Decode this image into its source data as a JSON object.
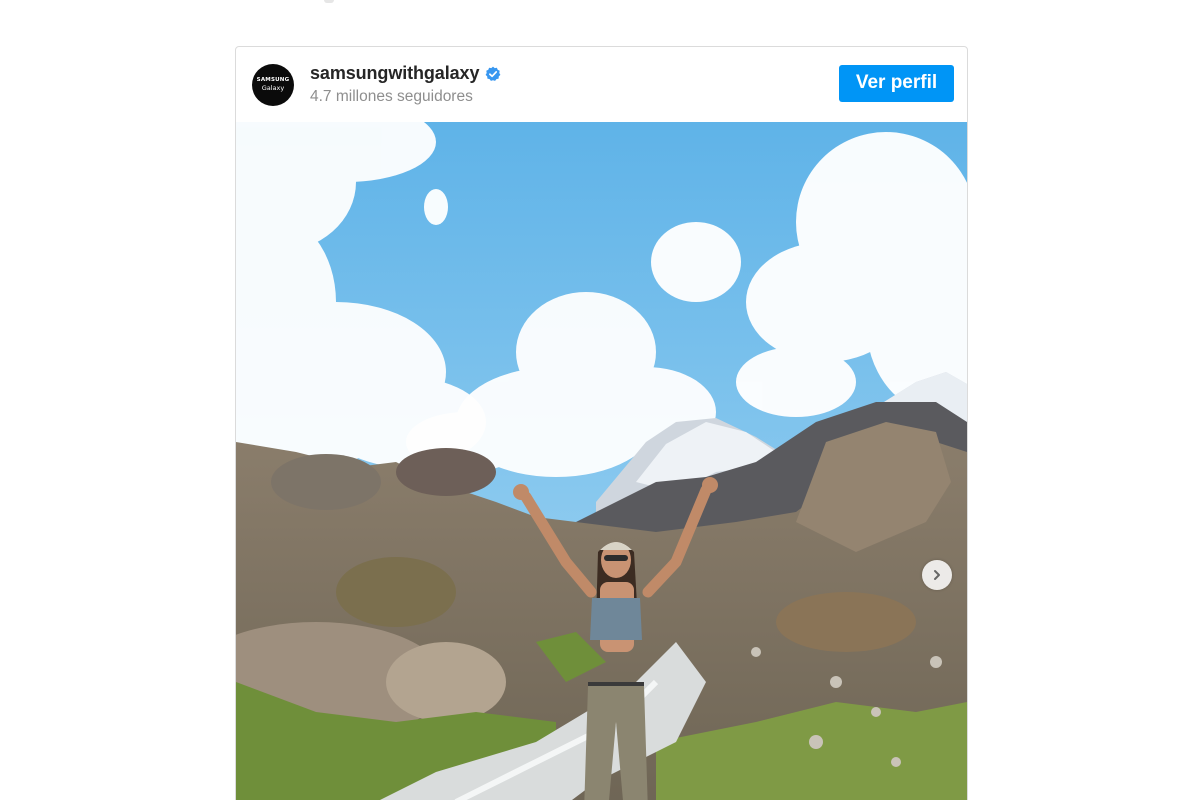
{
  "account": {
    "username": "samsungwithgalaxy",
    "followers": "4.7 millones seguidores",
    "avatar_text_line1": "SAMSUNG",
    "avatar_text_line2": "Galaxy",
    "verified": true
  },
  "actions": {
    "view_profile_label": "Ver perfil"
  },
  "media": {
    "description_icon": "photo",
    "carousel_next_icon": "chevron-right-icon"
  },
  "colors": {
    "button": "#0095f6",
    "verified_badge": "#3897f0",
    "username": "#262626",
    "secondary_text": "#8e8e8e",
    "border": "#dbdbdb"
  }
}
